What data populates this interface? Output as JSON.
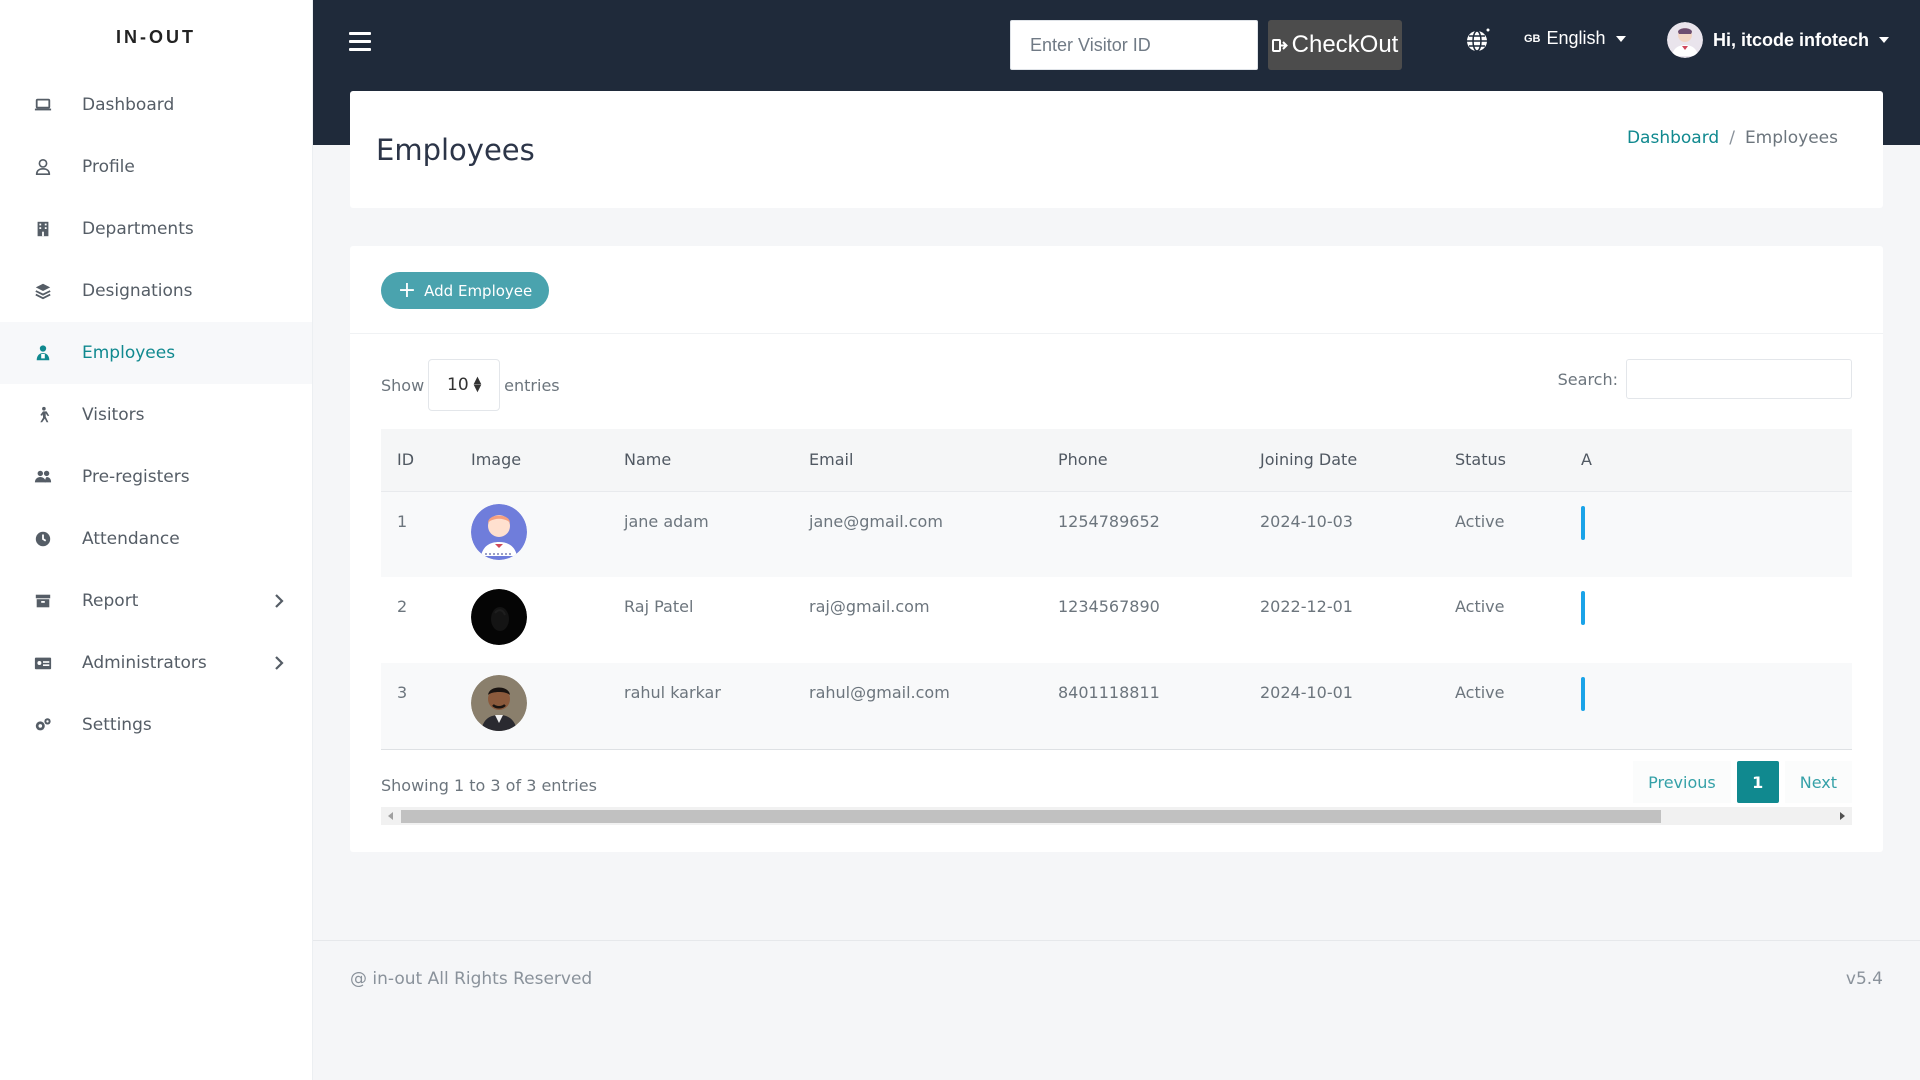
{
  "brand": "IN-OUT",
  "sidebar": {
    "items": [
      {
        "label": "Dashboard",
        "icon": "laptop-icon"
      },
      {
        "label": "Profile",
        "icon": "user-icon"
      },
      {
        "label": "Departments",
        "icon": "building-icon"
      },
      {
        "label": "Designations",
        "icon": "layers-icon"
      },
      {
        "label": "Employees",
        "icon": "employee-icon",
        "active": true
      },
      {
        "label": "Visitors",
        "icon": "walking-icon"
      },
      {
        "label": "Pre-registers",
        "icon": "users-icon"
      },
      {
        "label": "Attendance",
        "icon": "clock-icon"
      },
      {
        "label": "Report",
        "icon": "archive-icon",
        "has_submenu": true
      },
      {
        "label": "Administrators",
        "icon": "id-card-icon",
        "has_submenu": true
      },
      {
        "label": "Settings",
        "icon": "cogs-icon"
      }
    ]
  },
  "topbar": {
    "visitor_placeholder": "Enter Visitor ID",
    "checkout_label": "CheckOut",
    "lang_flag": "GB",
    "lang_label": "English",
    "user_label": "Hi, itcode infotech"
  },
  "page": {
    "title": "Employees",
    "breadcrumb": {
      "home": "Dashboard",
      "separator": "/",
      "current": "Employees"
    }
  },
  "card": {
    "add_button": "Add Employee",
    "show_label": "Show",
    "page_length": "10",
    "entries_label": "entries",
    "search_label": "Search:",
    "columns": [
      "ID",
      "Image",
      "Name",
      "Email",
      "Phone",
      "Joining Date",
      "Status",
      "A"
    ],
    "rows": [
      {
        "id": "1",
        "image": "avatar-cartoon",
        "name": "jane adam",
        "email": "jane@gmail.com",
        "phone": "1254789652",
        "joining_date": "2024-10-03",
        "status": "Active"
      },
      {
        "id": "2",
        "image": "avatar-dark",
        "name": "Raj Patel",
        "email": "raj@gmail.com",
        "phone": "1234567890",
        "joining_date": "2022-12-01",
        "status": "Active"
      },
      {
        "id": "3",
        "image": "avatar-photo",
        "name": "rahul karkar",
        "email": "rahul@gmail.com",
        "phone": "8401118811",
        "joining_date": "2024-10-01",
        "status": "Active"
      }
    ],
    "info": "Showing 1 to 3 of 3 entries",
    "pager": {
      "prev": "Previous",
      "current": "1",
      "next": "Next"
    }
  },
  "footer": {
    "copyright": "@ in-out All Rights Reserved",
    "version": "v5.4"
  },
  "colors": {
    "accent": "#10898f",
    "topbar": "#1f2a3a",
    "add_button": "#4aa3ae",
    "action_bar": "#1aa3e8"
  }
}
